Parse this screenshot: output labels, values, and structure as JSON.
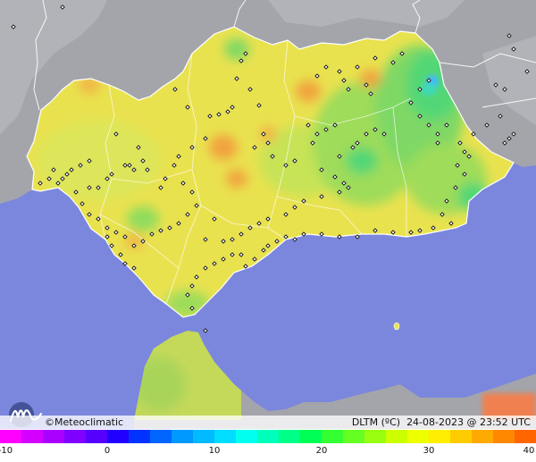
{
  "map": {
    "colors": {
      "sea": "#7B87DD",
      "land_outside": "#A3A5AB",
      "region_base": "#E9E24F",
      "border": "#FFFFFF",
      "station": "#111111"
    },
    "icon": "station-marker-icon"
  },
  "brand": {
    "name": "Meteoclimatic",
    "copyright_symbol": "©",
    "logo_icon": "meteoclimatic-logo-icon"
  },
  "info": {
    "variable": "DLTM (ºC)",
    "datetime": "24-08-2023 @ 23:52 UTC"
  },
  "legend": {
    "ticks": [
      "-10",
      "0",
      "10",
      "20",
      "30",
      "40"
    ],
    "range": [
      -10,
      40
    ],
    "step": 2,
    "colors": [
      "#FF00FF",
      "#D400FF",
      "#AA00FF",
      "#8000FF",
      "#5500FF",
      "#2200FF",
      "#0033FF",
      "#0066FF",
      "#0099FF",
      "#00BBFF",
      "#00DDFF",
      "#00FFEE",
      "#00FFBB",
      "#00FF88",
      "#00FF55",
      "#33FF33",
      "#66FF22",
      "#99FF11",
      "#CCFF00",
      "#EEFF00",
      "#FFEE00",
      "#FFCC00",
      "#FFAA00",
      "#FF8800",
      "#FF6600"
    ]
  }
}
